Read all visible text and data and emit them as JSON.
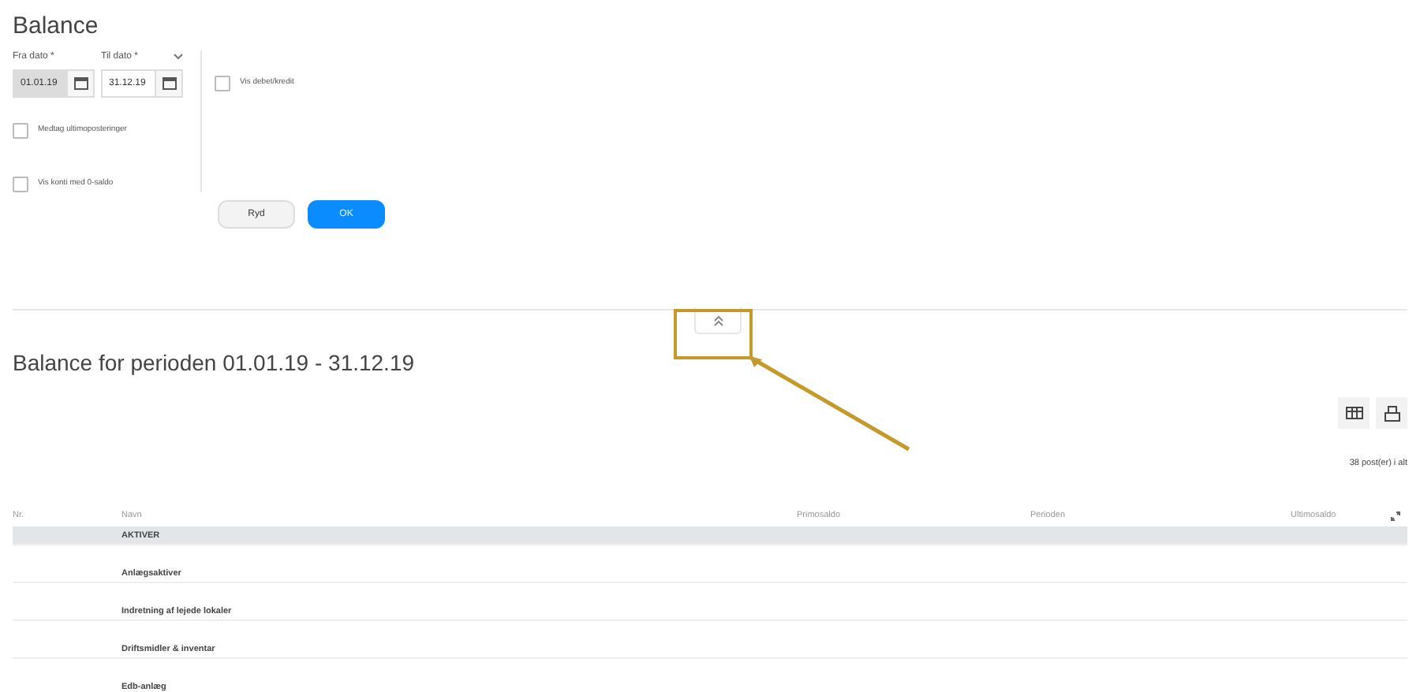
{
  "title": "Balance",
  "date_fields": [
    {
      "label": "Fra dato *",
      "value": "01.01.19",
      "highlighted": true
    },
    {
      "label": "Til dato *",
      "value": "31.12.19",
      "highlighted": false
    }
  ],
  "checkboxes_right": [
    {
      "label": "Vis debet/kredit",
      "checked": false
    }
  ],
  "checkboxes_left": [
    {
      "label": "Medtag ultimoposteringer",
      "checked": false
    },
    {
      "label": "Vis konti med 0-saldo",
      "checked": false
    }
  ],
  "buttons": [
    {
      "label": "Ryd",
      "kind": "secondary"
    },
    {
      "label": "OK",
      "kind": "primary"
    }
  ],
  "result_title": "Balance for perioden 01.01.19 - 31.12.19",
  "count": "38 post(er) i alt",
  "table": {
    "columns": [
      "Nr.",
      "Navn",
      "Primosaldo",
      "Perioden",
      "Ultimosaldo"
    ],
    "rows": [
      {
        "name": "AKTIVER",
        "selected": true
      },
      {
        "name": "Anlægsaktiver",
        "selected": false
      },
      {
        "name": "Indretning af lejede lokaler",
        "selected": false
      },
      {
        "name": "Driftsmidler & inventar",
        "selected": false
      },
      {
        "name": "Edb-anlæg",
        "selected": false
      }
    ]
  }
}
